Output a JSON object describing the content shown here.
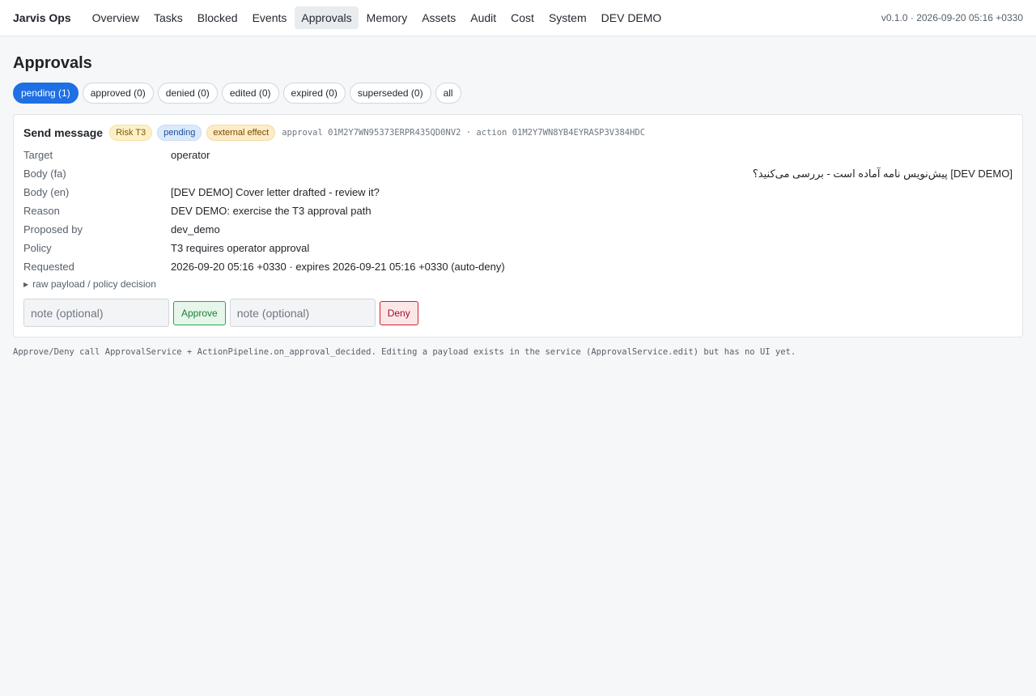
{
  "header": {
    "brand": "Jarvis Ops",
    "nav": [
      "Overview",
      "Tasks",
      "Blocked",
      "Events",
      "Approvals",
      "Memory",
      "Assets",
      "Audit",
      "Cost",
      "System",
      "DEV DEMO"
    ],
    "active_nav": "Approvals",
    "version": "v0.1.0 · 2026-09-20 05:16 +0330"
  },
  "page": {
    "title": "Approvals",
    "filters": [
      "pending (1)",
      "approved (0)",
      "denied (0)",
      "edited (0)",
      "expired (0)",
      "superseded (0)",
      "all"
    ],
    "active_filter": "pending (1)"
  },
  "approval": {
    "title": "Send message",
    "badges": {
      "risk": "Risk T3",
      "status": "pending",
      "effect": "external effect"
    },
    "ids": "approval 01M2Y7WN95373ERPR435QD0NV2 · action 01M2Y7WN8YB4EYRASP3V384HDC",
    "fields": {
      "target": {
        "label": "Target",
        "value": "operator"
      },
      "body_fa": {
        "label": "Body (fa)",
        "value": "[DEV DEMO] پیش‌نویس نامه آماده است - بررسی می‌کنید؟"
      },
      "body_en": {
        "label": "Body (en)",
        "value": "[DEV DEMO] Cover letter drafted - review it?"
      },
      "reason": {
        "label": "Reason",
        "value": "DEV DEMO: exercise the T3 approval path"
      },
      "proposed_by": {
        "label": "Proposed by",
        "value": "dev_demo"
      },
      "policy": {
        "label": "Policy",
        "value": "T3 requires operator approval"
      },
      "requested": {
        "label": "Requested",
        "value": "2026-09-20 05:16 +0330 · expires 2026-09-21 05:16 +0330 (auto-deny)"
      }
    },
    "details_label": "raw payload / policy decision",
    "approve_note_placeholder": "note (optional)",
    "approve_label": "Approve",
    "deny_note_placeholder": "note (optional)",
    "deny_label": "Deny"
  },
  "footnote": "Approve/Deny call ApprovalService + ActionPipeline.on_approval_decided. Editing a payload exists in the service (ApprovalService.edit) but has no UI yet.",
  "colors": {
    "accent": "#1f6fe5",
    "approve": "#1a7f37",
    "deny": "#a40e26"
  }
}
